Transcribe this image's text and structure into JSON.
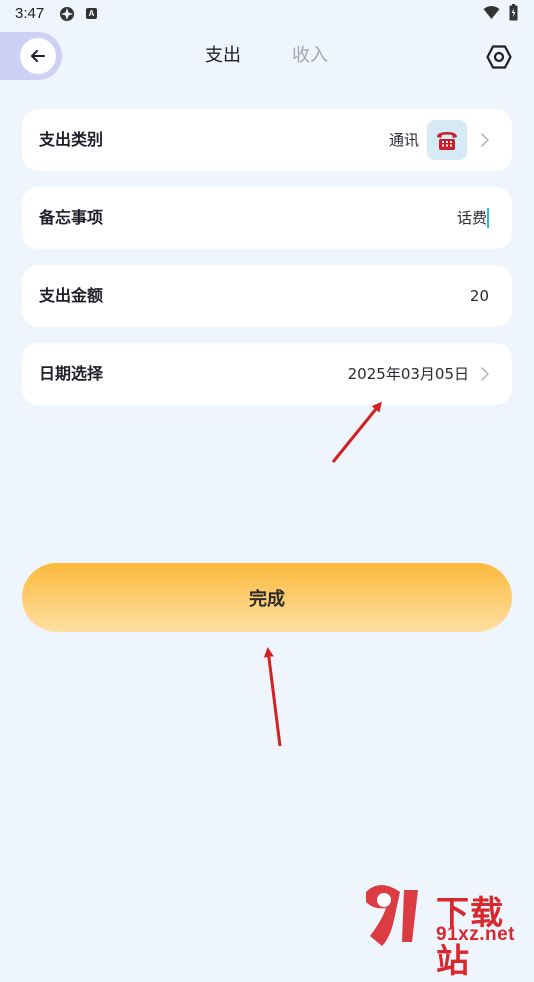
{
  "status_bar": {
    "time": "3:47"
  },
  "header": {
    "tabs": [
      {
        "label": "支出",
        "active": true
      },
      {
        "label": "收入",
        "active": false
      }
    ]
  },
  "form": {
    "category": {
      "label": "支出类别",
      "value": "通讯",
      "icon": "telephone-icon"
    },
    "memo": {
      "label": "备忘事项",
      "value": "话费"
    },
    "amount": {
      "label": "支出金额",
      "value": "20"
    },
    "date": {
      "label": "日期选择",
      "value": "2025年03月05日"
    }
  },
  "done_button": {
    "label": "完成"
  },
  "watermark": {
    "line1": "下载站",
    "line2": "91xz.net"
  },
  "colors": {
    "background": "#eef5fd",
    "accent_button": "#fdb93b",
    "back_pill": "#cfd0f6",
    "inactive_tab": "#a2a6b2",
    "annotation_arrow": "#d42020"
  }
}
